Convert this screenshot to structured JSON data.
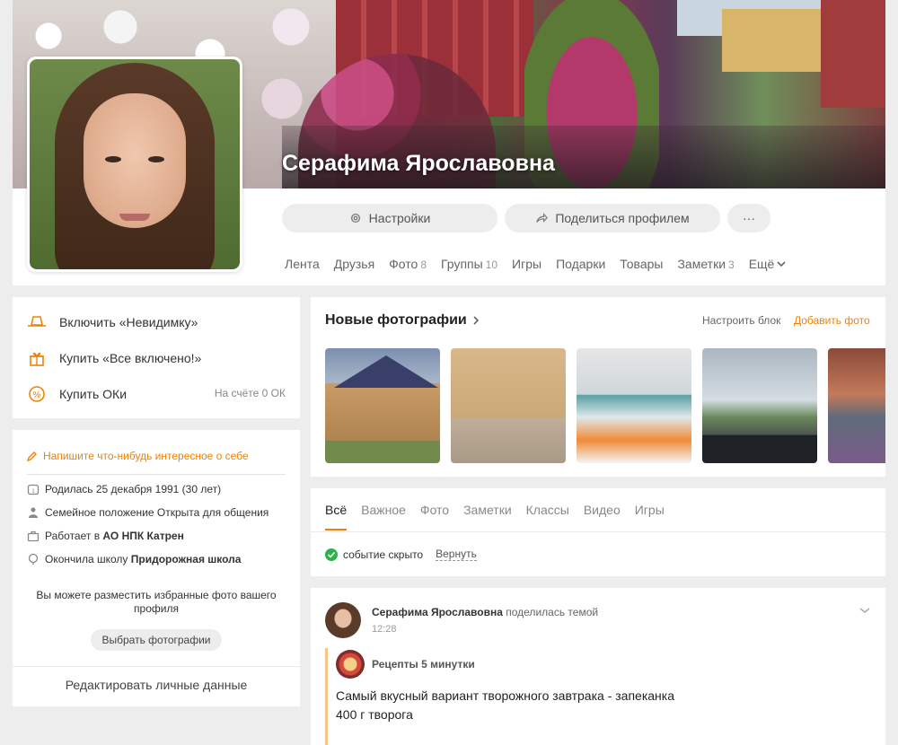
{
  "profile": {
    "name": "Серафима Ярославовна",
    "actions": {
      "settings_label": "Настройки",
      "share_label": "Поделиться профилем",
      "more_label": "···"
    },
    "nav": [
      {
        "label": "Лента",
        "count": ""
      },
      {
        "label": "Друзья",
        "count": ""
      },
      {
        "label": "Фото",
        "count": "8"
      },
      {
        "label": "Группы",
        "count": "10"
      },
      {
        "label": "Игры",
        "count": ""
      },
      {
        "label": "Подарки",
        "count": ""
      },
      {
        "label": "Товары",
        "count": ""
      },
      {
        "label": "Заметки",
        "count": "3"
      },
      {
        "label": "Ещё",
        "count": ""
      }
    ]
  },
  "sidebar": {
    "actions": [
      {
        "label": "Включить «Невидимку»",
        "icon": "hat-icon"
      },
      {
        "label": "Купить «Все включено!»",
        "icon": "gift-icon"
      },
      {
        "label": "Купить ОКи",
        "icon": "coin-icon"
      }
    ],
    "balance": "На счёте 0 ОК",
    "about_prompt": "Напишите что-нибудь интересное о себе",
    "info": [
      {
        "icon": "calendar-icon",
        "text": "Родилась 25 декабря 1991 (30 лет)",
        "bold": ""
      },
      {
        "icon": "people-icon",
        "text": "Семейное положение Открыта для общения",
        "bold": ""
      },
      {
        "icon": "briefcase-icon",
        "text": "Работает в ",
        "bold": "АО НПК Катрен"
      },
      {
        "icon": "school-icon",
        "text": "Окончила школу ",
        "bold": "Придорожная школа"
      }
    ],
    "favorites_text": "Вы можете разместить избранные фото вашего профиля",
    "choose_photos_label": "Выбрать фотографии",
    "edit_label": "Редактировать личные данные"
  },
  "photos": {
    "title": "Новые фотографии",
    "configure_label": "Настроить блок",
    "add_label": "Добавить фото"
  },
  "feed": {
    "tabs": [
      "Всё",
      "Важное",
      "Фото",
      "Заметки",
      "Классы",
      "Видео",
      "Игры"
    ],
    "hidden_note": "событие скрыто",
    "restore_label": "Вернуть"
  },
  "post": {
    "author": "Серафима Ярославовна",
    "action": "поделилась темой",
    "time": "12:28",
    "group": "Рецепты 5 минутки",
    "line1": "Самый вкусный вариант творожного завтрака - запеканка",
    "line2": "400 г творога"
  },
  "colors": {
    "accent": "#ee8208",
    "success": "#2bb24c"
  }
}
